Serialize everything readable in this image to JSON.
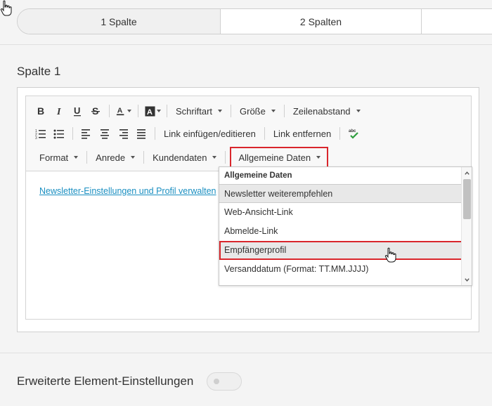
{
  "column_tabs": [
    "1 Spalte",
    "2 Spalten",
    ""
  ],
  "section_title": "Spalte 1",
  "toolbar": {
    "font_label": "Schriftart",
    "size_label": "Größe",
    "line_spacing_label": "Zeilenabstand",
    "insert_link_label": "Link einfügen/editieren",
    "remove_link_label": "Link entfernen",
    "format_label": "Format",
    "salutation_label": "Anrede",
    "customer_data_label": "Kundendaten",
    "general_data_label": "Allgemeine Daten"
  },
  "content": {
    "link_text": "Newsletter-Einstellungen und Profil verwalten"
  },
  "dropdown": {
    "header": "Allgemeine Daten",
    "items": [
      "Newsletter weiterempfehlen",
      "Web-Ansicht-Link",
      "Abmelde-Link",
      "Empfängerprofil",
      "Versanddatum (Format: TT.MM.JJJJ)"
    ],
    "selected_index": 3
  },
  "extended_settings": {
    "label": "Erweiterte Element-Einstellungen",
    "enabled": false
  },
  "colors": {
    "highlight": "#d9262c",
    "link": "#1a8fc1"
  }
}
